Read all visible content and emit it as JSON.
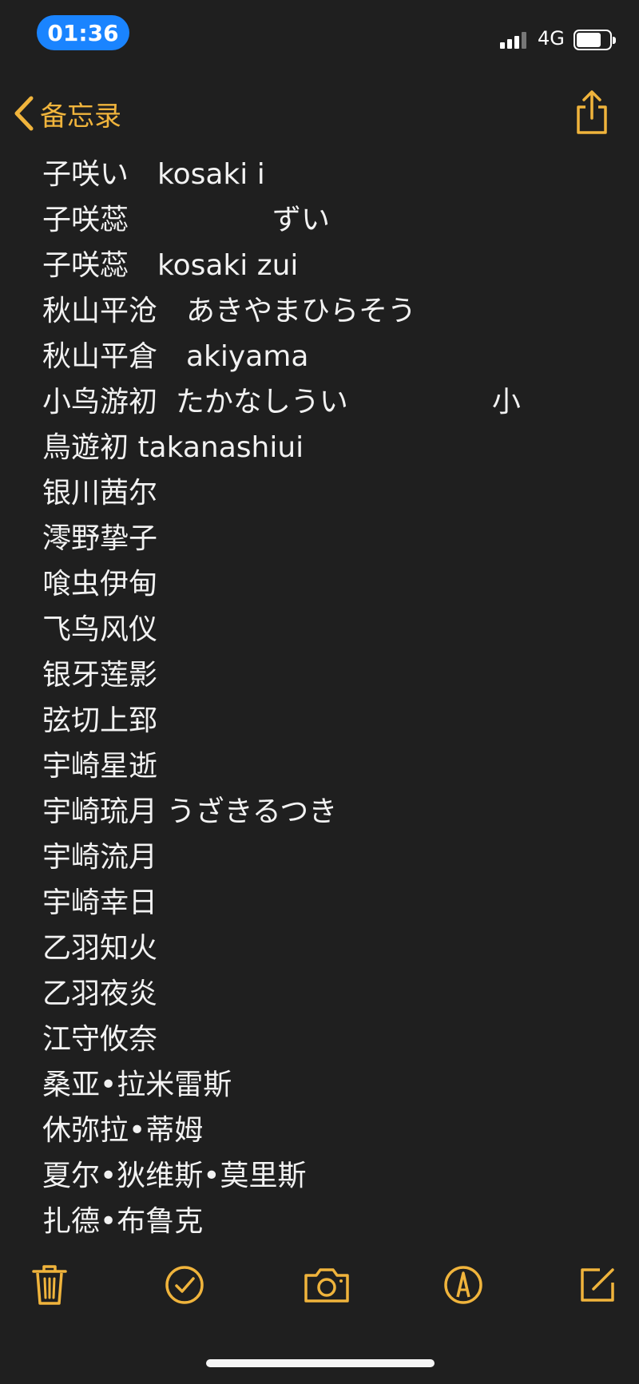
{
  "status_bar": {
    "time": "01:36",
    "network": "4G"
  },
  "nav": {
    "back_label": "备忘录"
  },
  "note": {
    "lines": [
      "子咲い　kosaki i",
      "子咲蕊　　　　　ずい",
      "子咲蕊　kosaki zui",
      "秋山平沧　あきやまひらそう",
      "秋山平倉　akiyama",
      "小鸟游初  たかなしうい　　　　　小",
      "鳥遊初 takanashiui",
      "银川茜尔",
      "澪野挚子",
      "喰虫伊甸",
      "飞鸟风仪",
      "银牙莲影",
      "弦切上郅",
      "宇崎星逝",
      "宇崎琉月 うざきるつき",
      "宇崎流月",
      "宇崎幸日",
      "乙羽知火",
      "乙羽夜炎",
      "江守攸奈",
      "桑亚•拉米雷斯",
      "休弥拉•蒂姆",
      "夏尔•狄维斯•莫里斯",
      "扎德•布鲁克"
    ]
  },
  "colors": {
    "accent": "#f0b43c",
    "background": "#1f1f1f",
    "time_pill": "#1a84ff"
  },
  "toolbar": {
    "icons": [
      "trash-icon",
      "checklist-icon",
      "camera-icon",
      "markup-icon",
      "compose-icon"
    ]
  }
}
